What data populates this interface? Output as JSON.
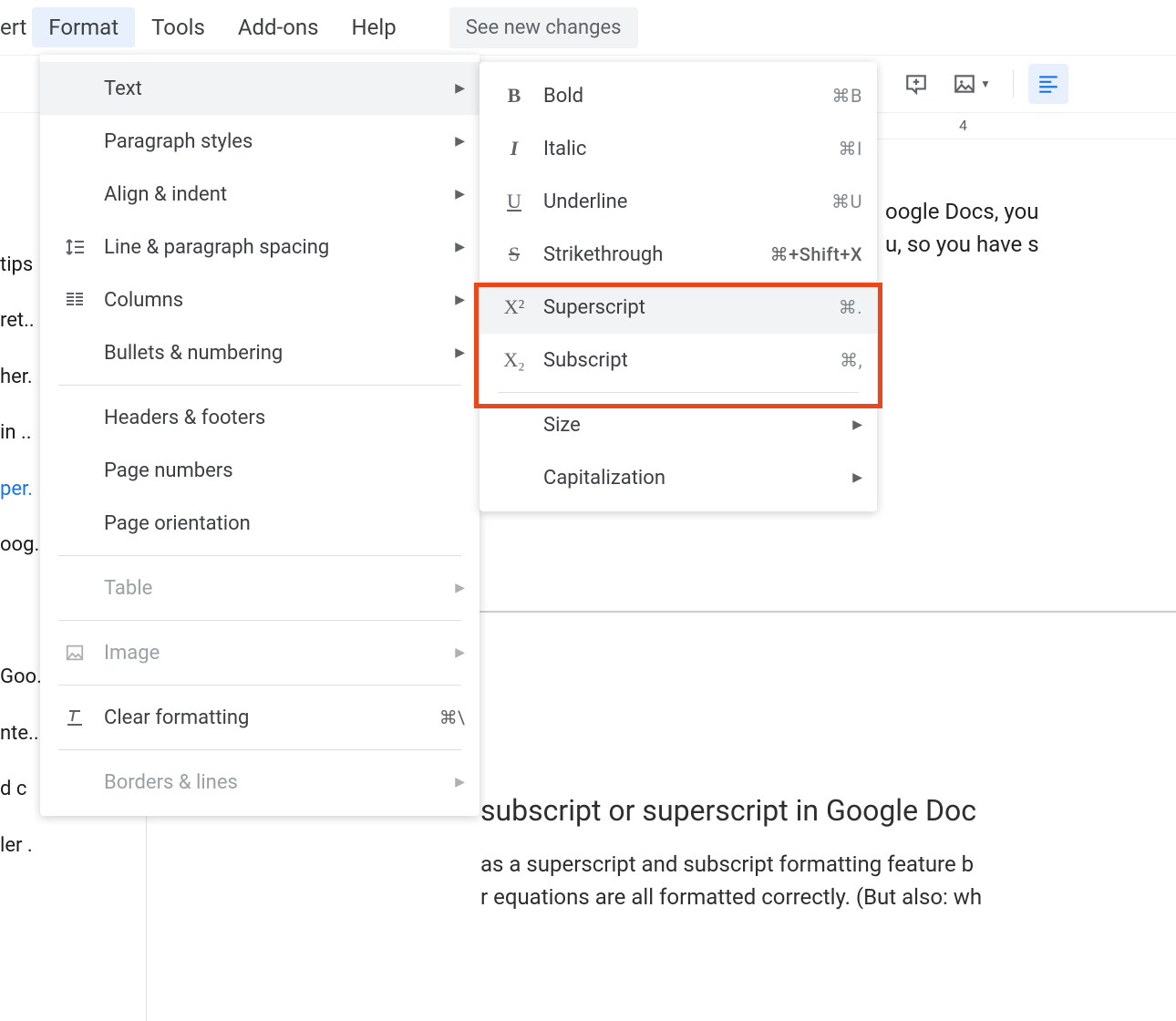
{
  "menubar": {
    "items": [
      {
        "label": "ert"
      },
      {
        "label": "Format"
      },
      {
        "label": "Tools"
      },
      {
        "label": "Add-ons"
      },
      {
        "label": "Help"
      }
    ],
    "new_changes": "See new changes"
  },
  "toolbar": {
    "comment": "add-comment",
    "image": "insert-image",
    "align": "align-left"
  },
  "ruler": {
    "tick": "4"
  },
  "left_snippets": [
    "tips",
    "ret..",
    "her.",
    "in ..",
    "per.",
    "oog.",
    "",
    "Goo.",
    "nte..",
    "d c",
    "ler ."
  ],
  "format_menu": {
    "items": [
      {
        "label": "Text",
        "submenu": true,
        "highlight": true
      },
      {
        "label": "Paragraph styles",
        "submenu": true
      },
      {
        "label": "Align & indent",
        "submenu": true
      },
      {
        "label": "Line & paragraph spacing",
        "submenu": true,
        "icon": "line-spacing"
      },
      {
        "label": "Columns",
        "submenu": true,
        "icon": "columns"
      },
      {
        "label": "Bullets & numbering",
        "submenu": true
      }
    ],
    "items2": [
      {
        "label": "Headers & footers"
      },
      {
        "label": "Page numbers"
      },
      {
        "label": "Page orientation"
      }
    ],
    "items3": [
      {
        "label": "Table",
        "submenu": true,
        "disabled": true
      }
    ],
    "items4": [
      {
        "label": "Image",
        "submenu": true,
        "disabled": true,
        "icon": "image"
      }
    ],
    "items5": [
      {
        "label": "Clear formatting",
        "shortcut": "⌘\\",
        "icon": "clear-format"
      }
    ],
    "items6": [
      {
        "label": "Borders & lines",
        "submenu": true,
        "disabled": true
      }
    ]
  },
  "text_submenu": {
    "items": [
      {
        "label": "Bold",
        "shortcut": "⌘B",
        "icon": "B",
        "iconstyle": "font-weight:700"
      },
      {
        "label": "Italic",
        "shortcut": "⌘I",
        "icon": "I",
        "iconstyle": "font-style:italic;font-family:serif;font-weight:700"
      },
      {
        "label": "Underline",
        "shortcut": "⌘U",
        "icon": "U",
        "iconstyle": "text-decoration:underline;font-family:serif"
      },
      {
        "label": "Strikethrough",
        "shortcut": "⌘+Shift+X",
        "icon": "S",
        "iconstyle": "text-decoration:line-through;font-family:serif;font-weight:500",
        "shortcut_strong": true
      },
      {
        "label": "Superscript",
        "shortcut": "⌘.",
        "icon": "X²",
        "highlight": true
      },
      {
        "label": "Subscript",
        "shortcut": "⌘,",
        "icon": "X₂"
      }
    ],
    "items2": [
      {
        "label": "Size",
        "submenu": true
      },
      {
        "label": "Capitalization",
        "submenu": true
      }
    ]
  },
  "document": {
    "top_line1": "oogle Docs, you",
    "top_line2": "u, so you have s",
    "heading": "subscript or superscript in Google Doc",
    "para1": "as a superscript and subscript formatting feature b",
    "para2": "r equations are all formatted correctly. (But also: wh"
  }
}
